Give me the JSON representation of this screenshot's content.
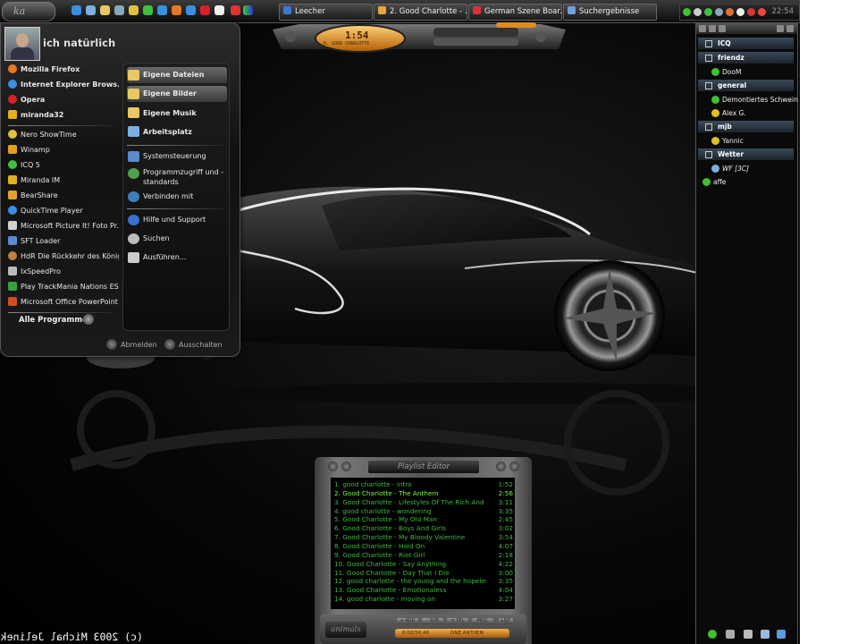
{
  "taskbar": {
    "start_logo": "ka",
    "tasks": [
      {
        "label": "Leecher",
        "color": "#3a7bd5"
      },
      {
        "label": "2. Good Charlotte - ...",
        "color": "#e8a83a"
      },
      {
        "label": "German Szene Boar...",
        "color": "#d33"
      },
      {
        "label": "Suchergebnisse",
        "color": "#6fa0e0"
      }
    ],
    "clock": "22:54"
  },
  "start_menu": {
    "user_name": "ich natürlich",
    "pinned": [
      {
        "label": "Mozilla Firefox",
        "icon": "firefox-icon",
        "color": "#e87722"
      },
      {
        "label": "Internet Explorer Brows...",
        "icon": "internet-explorer-icon",
        "color": "#3a8fe0"
      },
      {
        "label": "Opera",
        "icon": "opera-icon",
        "color": "#d8202a"
      },
      {
        "label": "miranda32",
        "icon": "miranda-icon",
        "color": "#e0b020"
      }
    ],
    "recent": [
      {
        "label": "Nero ShowTime",
        "icon": "nero-showtime-icon",
        "color": "#e0c040"
      },
      {
        "label": "Winamp",
        "icon": "winamp-icon",
        "color": "#e0a020"
      },
      {
        "label": "ICQ 5",
        "icon": "icq-icon",
        "color": "#40c040"
      },
      {
        "label": "Miranda IM",
        "icon": "miranda-im-icon",
        "color": "#e0b020"
      },
      {
        "label": "BearShare",
        "icon": "bearshare-icon",
        "color": "#e0a030"
      },
      {
        "label": "QuickTime Player",
        "icon": "quicktime-icon",
        "color": "#3a90e0"
      },
      {
        "label": "Microsoft Picture It! Foto Pr...",
        "icon": "picture-it-icon",
        "color": "#d0d0d0"
      },
      {
        "label": "SFT Loader",
        "icon": "sft-loader-icon",
        "color": "#5a8ad0"
      },
      {
        "label": "HdR Die Rückkehr des König...",
        "icon": "hdr-icon",
        "color": "#c08040"
      },
      {
        "label": "IxSpeedPro",
        "icon": "ixspeedpro-icon",
        "color": "#bbbbbb"
      },
      {
        "label": "Play TrackMania Nations ESWC",
        "icon": "trackmania-icon",
        "color": "#3aa040"
      },
      {
        "label": "Microsoft Office PowerPoint ...",
        "icon": "powerpoint-icon",
        "color": "#d05020"
      }
    ],
    "all_programs": "Alle Programme",
    "right": [
      {
        "label": "Eigene Dateien",
        "icon": "folder-icon",
        "color": "#e8c860",
        "bold": true,
        "highlight": true
      },
      {
        "label": "Eigene Bilder",
        "icon": "pictures-folder-icon",
        "color": "#e8c860",
        "bold": true,
        "highlight": true
      },
      {
        "label": "Eigene Musik",
        "icon": "music-folder-icon",
        "color": "#e8c860",
        "bold": true
      },
      {
        "label": "Arbeitsplatz",
        "icon": "computer-icon",
        "color": "#7ab0e0",
        "bold": true
      },
      {
        "label": "Systemsteuerung",
        "icon": "control-panel-icon",
        "color": "#5a8ad0"
      },
      {
        "label": "Programmzugriff und -standards",
        "icon": "program-defaults-icon",
        "color": "#50a050"
      },
      {
        "label": "Verbinden mit",
        "icon": "connect-icon",
        "color": "#3a80c0"
      },
      {
        "label": "Hilfe und Support",
        "icon": "help-icon",
        "color": "#3a70d0"
      },
      {
        "label": "Suchen",
        "icon": "search-icon",
        "color": "#bbbbbb"
      },
      {
        "label": "Ausführen...",
        "icon": "run-icon",
        "color": "#cccccc"
      }
    ],
    "logoff": "Abmelden",
    "shutdown": "Ausschalten"
  },
  "winamp": {
    "time": "1:54",
    "title": "6. GOOD CHARLOTTE"
  },
  "contacts": {
    "entries": [
      {
        "type": "group",
        "label": "ICQ"
      },
      {
        "type": "group",
        "label": "friendz"
      },
      {
        "type": "contact",
        "label": "DooM",
        "status_color": "#40c030"
      },
      {
        "type": "group",
        "label": "general"
      },
      {
        "type": "contact",
        "label": "Demontiertes Schwein",
        "status_color": "#40c030"
      },
      {
        "type": "contact",
        "label": "Alex G.",
        "status_color": "#e0c020"
      },
      {
        "type": "group",
        "label": "mjb"
      },
      {
        "type": "contact",
        "label": "Yannic",
        "status_color": "#e0c020"
      },
      {
        "type": "group",
        "label": "Wetter"
      },
      {
        "type": "contact",
        "label": "WF [3C]",
        "status_color": "#7ab0e0"
      },
      {
        "type": "root",
        "label": "affe",
        "status_color": "#40c030"
      }
    ]
  },
  "playlist": {
    "title": "Playlist Editor",
    "tracks": [
      {
        "title": "1. good charlotte - intro",
        "duration": "1:52"
      },
      {
        "title": "2. Good Charlotte - The Anthem",
        "duration": "2:56",
        "current": true
      },
      {
        "title": "3. Good Charlotte - Lifestyles Of The Rich And F...",
        "duration": "3:11"
      },
      {
        "title": "4. good charlotte - wondering",
        "duration": "3:35"
      },
      {
        "title": "5. Good Charlotte - My Old Man",
        "duration": "2:45"
      },
      {
        "title": "6. Good Charlotte - Boys And Girls",
        "duration": "3:02"
      },
      {
        "title": "7. Good Charlotte - My Bloody Valentine",
        "duration": "3:54"
      },
      {
        "title": "8. Good Charlotte - Hold On",
        "duration": "4:07"
      },
      {
        "title": "9. Good Charlotte - Riot Girl",
        "duration": "2:18"
      },
      {
        "title": "10. Good Charlotte - Say Anything",
        "duration": "4:22"
      },
      {
        "title": "11. Good Charlotte - Day That I Die",
        "duration": "3:00"
      },
      {
        "title": "12. good charlotte - the young and the hopeless",
        "duration": "3:35"
      },
      {
        "title": "13. Good Charlotte - Emotionaless",
        "duration": "4:04"
      },
      {
        "title": "14. good charlotte - moving on",
        "duration": "3:27"
      }
    ],
    "buttons": [
      "+ ADD",
      "- SUB",
      "≡ SEL",
      "MISC",
      "LIST"
    ],
    "info": "0:00/56:46",
    "info_right": "ONE ANTHEM",
    "logo": "animals"
  },
  "copyright": "(c) 2003 Michal Jelinek"
}
